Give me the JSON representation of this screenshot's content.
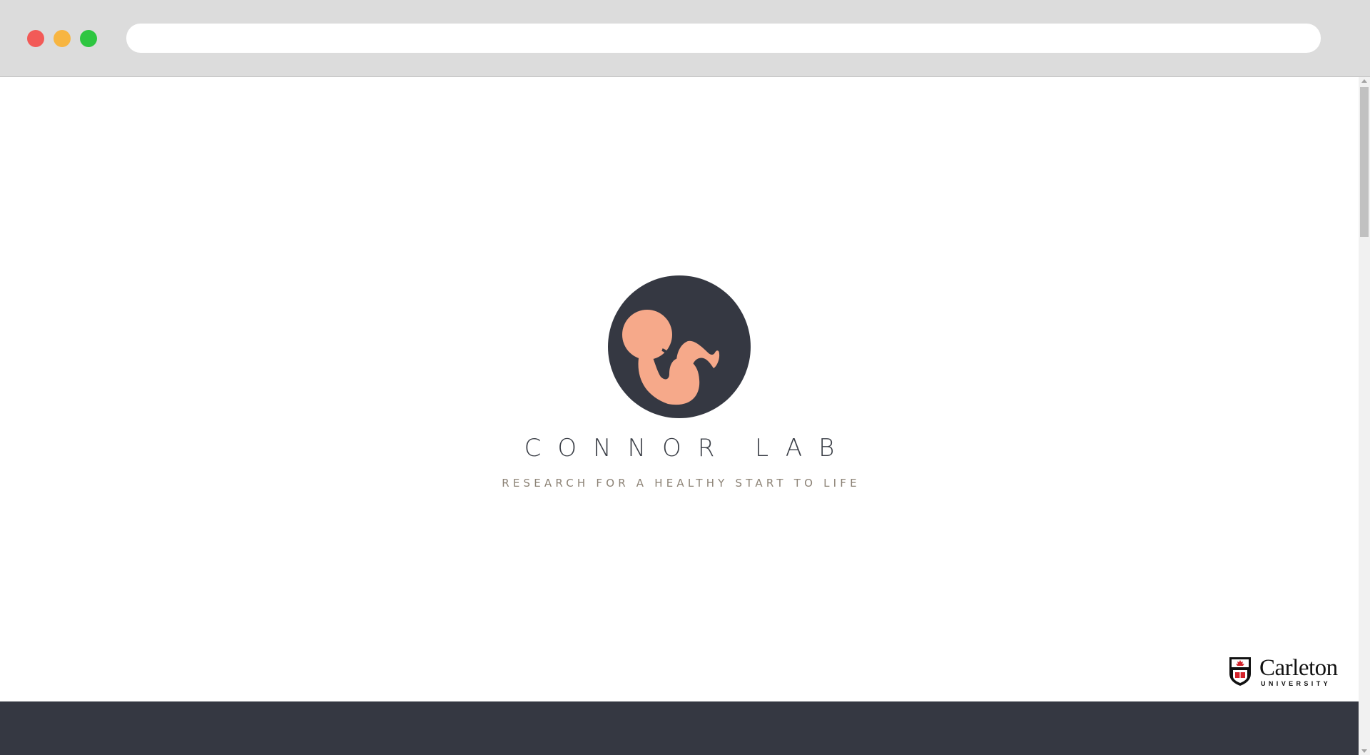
{
  "browser": {
    "url": "",
    "controls": {
      "close_color": "#f25a57",
      "minimize_color": "#f7b541",
      "maximize_color": "#2ec641"
    }
  },
  "hero": {
    "logo_icon": "fetus-icon",
    "logo_bg_color": "#353842",
    "logo_figure_color": "#f6a98a",
    "title": "CONNOR LAB",
    "tagline": "RESEARCH FOR A HEALTHY START TO LIFE"
  },
  "partner_logo": {
    "icon": "carleton-shield-icon",
    "name": "Carleton",
    "subtitle": "UNIVERSITY"
  },
  "footer": {
    "color": "#353842"
  }
}
